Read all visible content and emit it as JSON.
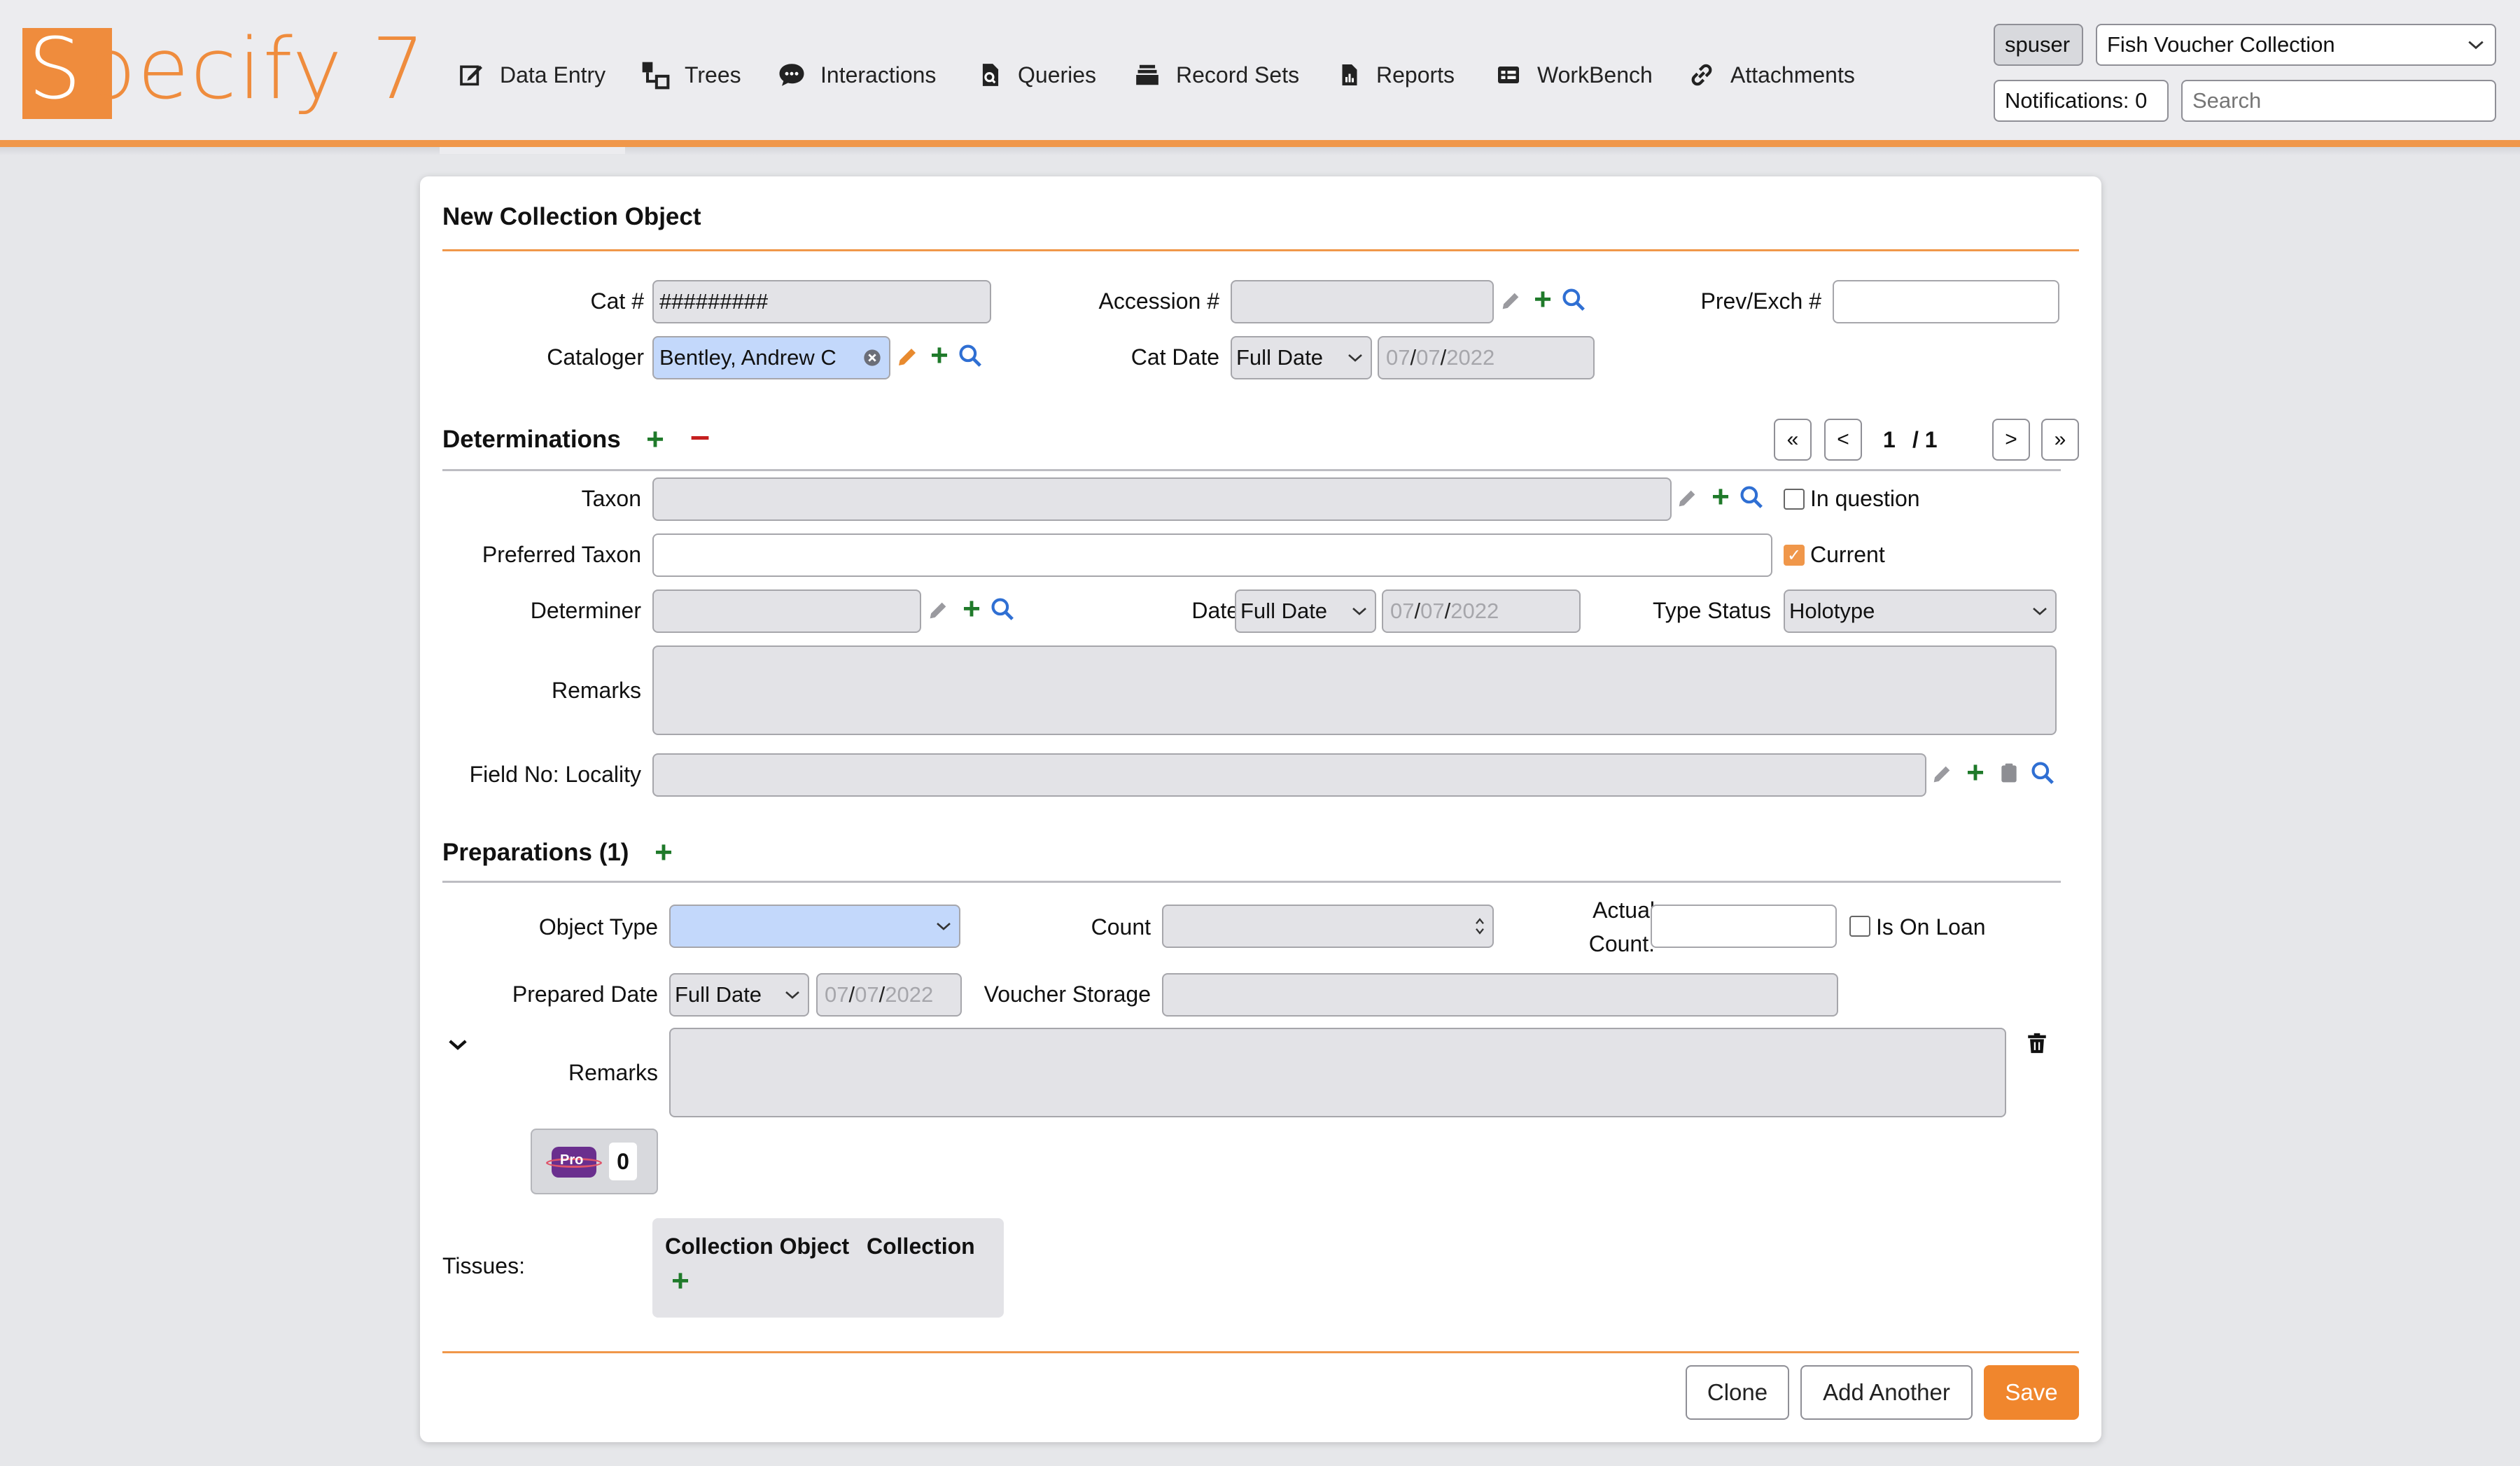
{
  "app": {
    "logo_text": "Specify 7",
    "user": "spuser",
    "collection": "Fish Voucher Collection",
    "notifications": "Notifications: 0",
    "search_placeholder": "Search"
  },
  "nav": [
    {
      "label": "Data Entry",
      "icon": "pencil-square-icon"
    },
    {
      "label": "Trees",
      "icon": "tree-hierarchy-icon"
    },
    {
      "label": "Interactions",
      "icon": "chat-bubble-icon"
    },
    {
      "label": "Queries",
      "icon": "document-search-icon"
    },
    {
      "label": "Record Sets",
      "icon": "stack-icon"
    },
    {
      "label": "Reports",
      "icon": "report-icon"
    },
    {
      "label": "WorkBench",
      "icon": "table-icon"
    },
    {
      "label": "Attachments",
      "icon": "link-icon"
    }
  ],
  "form": {
    "title": "New Collection Object",
    "cat_label": "Cat #",
    "cat_value": "#########",
    "accession_label": "Accession #",
    "accession_value": "",
    "prevexch_label": "Prev/Exch #",
    "prevexch_value": "",
    "cataloger_label": "Cataloger",
    "cataloger_value": "Bentley, Andrew C",
    "catdate_label": "Cat Date",
    "catdate_precision": "Full Date",
    "catdate_mm": "07",
    "catdate_dd": "07",
    "catdate_yyyy": "2022"
  },
  "determinations": {
    "title": "Determinations",
    "pager_current": "1",
    "pager_total": "/ 1",
    "taxon_label": "Taxon",
    "in_question_label": "In question",
    "preferred_taxon_label": "Preferred Taxon",
    "current_label": "Current",
    "determiner_label": "Determiner",
    "date_label": "Date",
    "date_precision": "Full Date",
    "date_mm": "07",
    "date_dd": "07",
    "date_yyyy": "2022",
    "type_status_label": "Type Status",
    "type_status_value": "Holotype",
    "remarks_label": "Remarks",
    "locality_label": "Field No: Locality"
  },
  "preparations": {
    "title": "Preparations (1)",
    "object_type_label": "Object Type",
    "count_label": "Count",
    "actual_count_label_1": "Actual",
    "actual_count_label_2": "Count:",
    "on_loan_label": "Is On Loan",
    "prepared_date_label": "Prepared Date",
    "prepared_precision": "Full Date",
    "prepared_mm": "07",
    "prepared_dd": "07",
    "prepared_yyyy": "2022",
    "voucher_storage_label": "Voucher Storage",
    "remarks_label": "Remarks",
    "attachment_count": "0",
    "attachment_badge": "Pro"
  },
  "tissues": {
    "label": "Tissues:",
    "col1": "Collection Object",
    "col2": "Collection"
  },
  "actions": {
    "clone": "Clone",
    "add_another": "Add Another",
    "save": "Save"
  }
}
